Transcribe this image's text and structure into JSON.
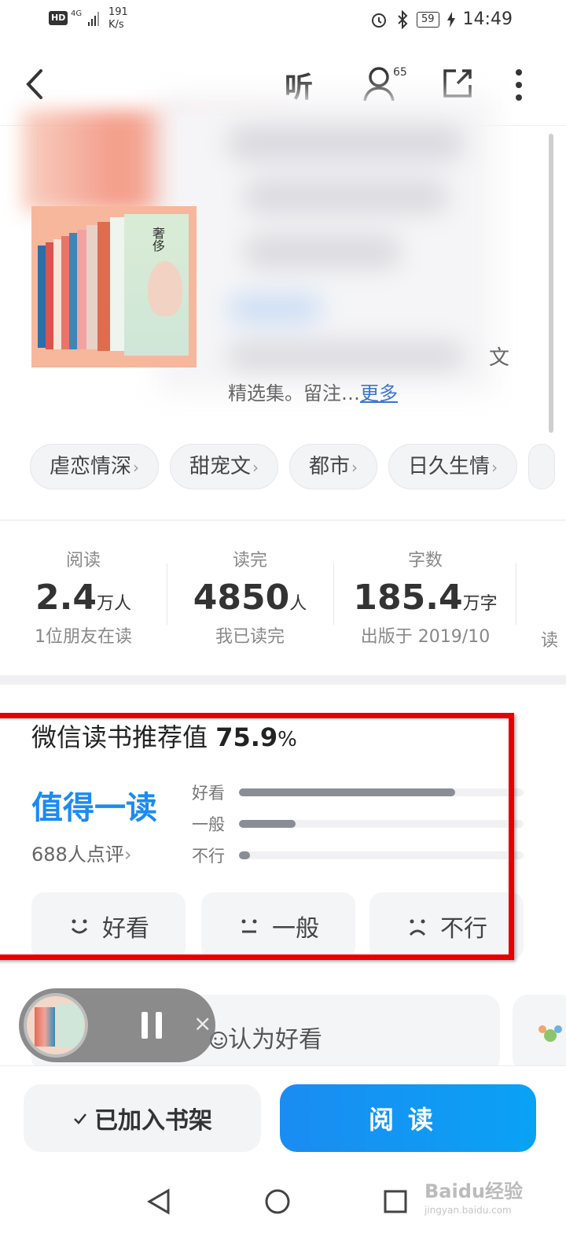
{
  "status_bar": {
    "hd": "HD",
    "network": "4G",
    "speed_value": "191",
    "speed_unit": "K/s",
    "battery": "59",
    "time": "14:49"
  },
  "nav": {
    "listen_label": "听",
    "listeners_count": "65"
  },
  "book": {
    "cover_title": "奢侈",
    "description_tail": "精选集。留注…",
    "description_more": "更多",
    "side_char_1": "文"
  },
  "tags": [
    {
      "label": "虐恋情深"
    },
    {
      "label": "甜宠文"
    },
    {
      "label": "都市"
    },
    {
      "label": "日久生情"
    }
  ],
  "stats": [
    {
      "label": "阅读",
      "value": "2.4",
      "unit": "万人",
      "sub": "1位朋友在读"
    },
    {
      "label": "读完",
      "value": "4850",
      "unit": "人",
      "sub": "我已读完"
    },
    {
      "label": "字数",
      "value": "185.4",
      "unit": "万字",
      "sub": "出版于 2019/10"
    }
  ],
  "stats_partial_sub": "读",
  "rating": {
    "title": "微信读书推荐值",
    "percent": "75.9",
    "percent_sign": "%",
    "verdict": "值得一读",
    "reviews": "688人点评",
    "bars": [
      {
        "label": "好看",
        "fraction": 0.76
      },
      {
        "label": "一般",
        "fraction": 0.2
      },
      {
        "label": "不行",
        "fraction": 0.04
      }
    ],
    "votes": [
      {
        "face": "◡",
        "label": "好看"
      },
      {
        "face": "‥",
        "label": "一般"
      },
      {
        "face": "⌒",
        "label": "不行"
      }
    ]
  },
  "review_card": {
    "text": "认为好看"
  },
  "actions": {
    "shelf": "已加入书架",
    "read": "阅读"
  },
  "watermark": {
    "brand": "Baidu经验",
    "url": "jingyan.baidu.com"
  },
  "colors": {
    "accent": "#1b8bf0",
    "highlight_box": "#e60000",
    "bar_fill": "#8a8d94"
  }
}
